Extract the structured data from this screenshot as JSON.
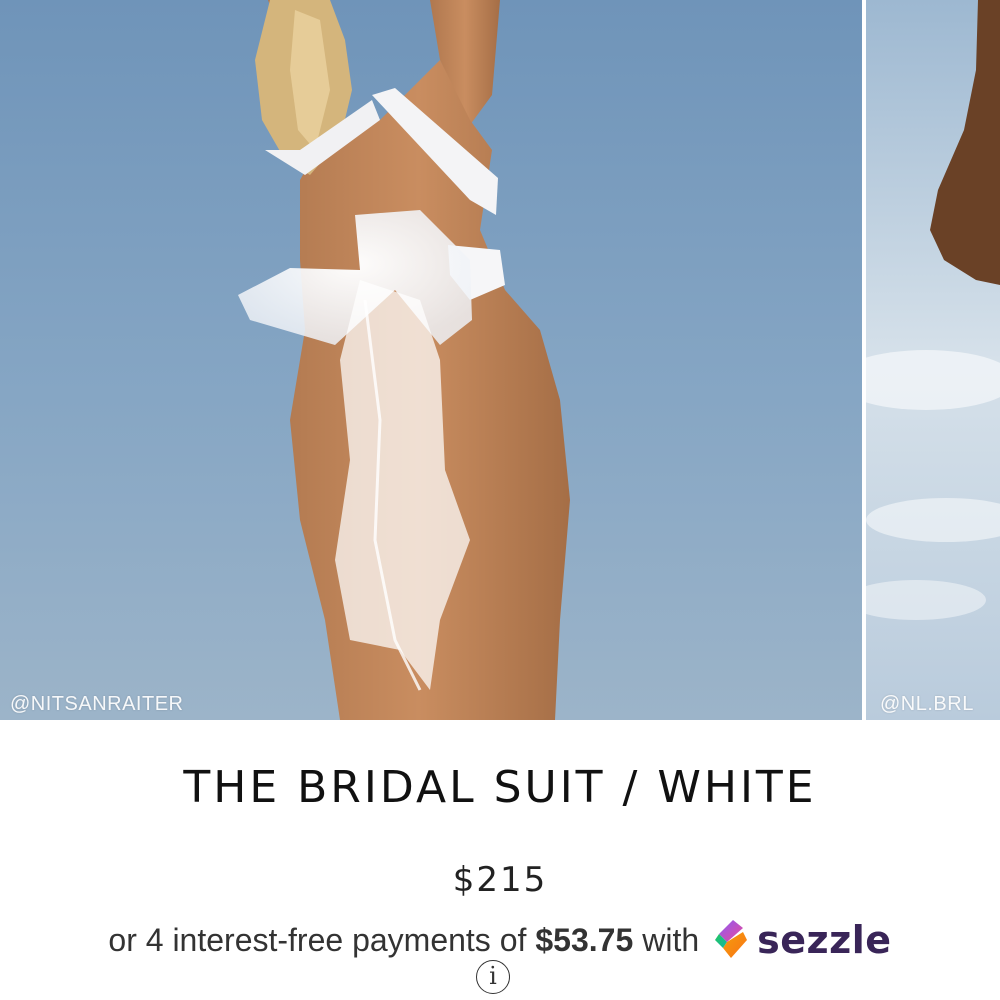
{
  "gallery": {
    "slides": [
      {
        "credit": "@NITSANRAITER",
        "icon": "product-photo"
      },
      {
        "credit": "@NL.BRL",
        "icon": "product-photo"
      }
    ]
  },
  "product": {
    "title": "THE BRIDAL SUIT / WHITE",
    "price": "$215"
  },
  "payment": {
    "prefix": "or 4 interest-free payments of",
    "amount": "$53.75",
    "suffix": "with",
    "provider": "sezzle",
    "provider_color": "#392558",
    "info_glyph": "i"
  }
}
